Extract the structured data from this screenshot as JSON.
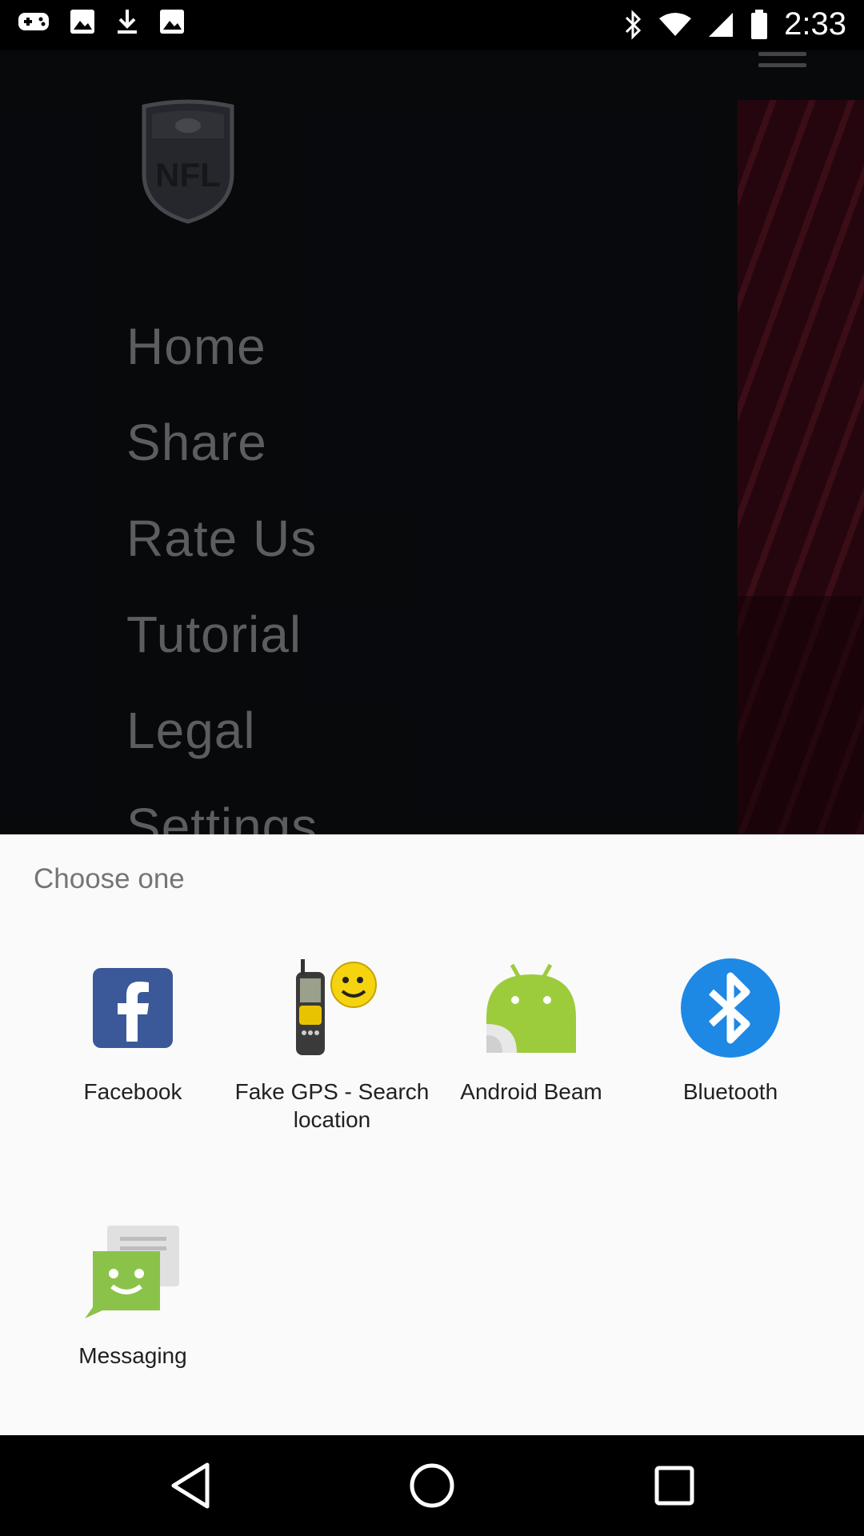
{
  "status_bar": {
    "time": "2:33",
    "left_icons": [
      "gamepad-icon",
      "image-icon",
      "download-icon",
      "image-icon"
    ],
    "right_icons": [
      "bluetooth-icon",
      "wifi-icon",
      "signal-icon",
      "battery-icon"
    ]
  },
  "background_app": {
    "logo_name": "nfl-logo",
    "logo_text": "NFL",
    "menu_items": [
      {
        "label": "Home"
      },
      {
        "label": "Share"
      },
      {
        "label": "Rate Us"
      },
      {
        "label": "Tutorial"
      },
      {
        "label": "Legal"
      },
      {
        "label": "Settings"
      }
    ]
  },
  "chooser": {
    "title": "Choose one",
    "apps": [
      {
        "label": "Facebook",
        "icon": "facebook-icon"
      },
      {
        "label": "Fake GPS - Search location",
        "icon": "fake-gps-icon"
      },
      {
        "label": "Android Beam",
        "icon": "android-beam-icon"
      },
      {
        "label": "Bluetooth",
        "icon": "bluetooth-icon"
      },
      {
        "label": "Messaging",
        "icon": "messaging-icon"
      }
    ]
  },
  "nav_bar": {
    "buttons": [
      "back-icon",
      "home-icon",
      "recents-icon"
    ]
  },
  "colors": {
    "facebook": "#3b5998",
    "android": "#9ccc3c",
    "bluetooth": "#1e88e5",
    "messaging": "#8bc34a",
    "sheet_bg": "#fafafa"
  }
}
